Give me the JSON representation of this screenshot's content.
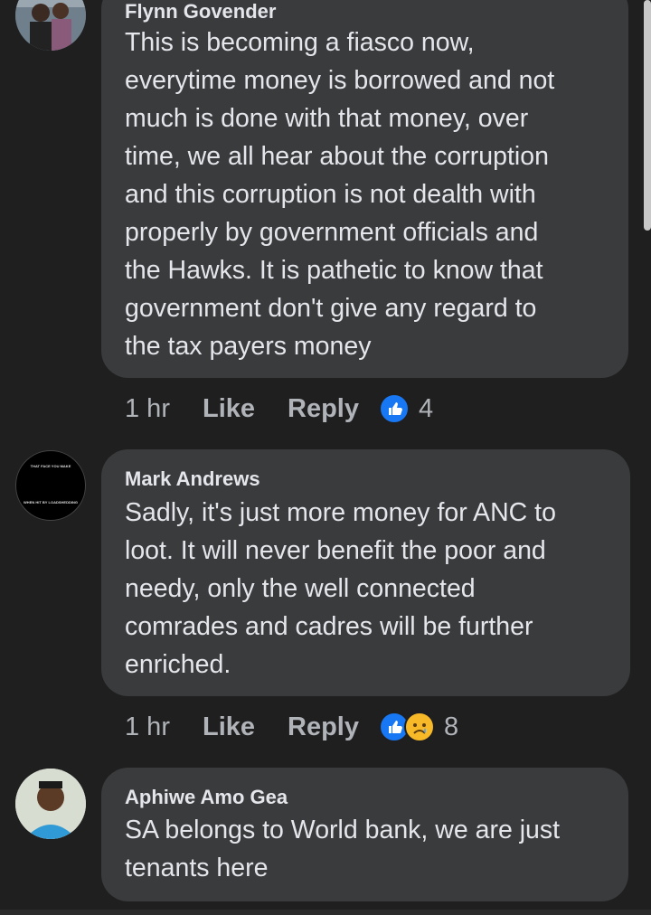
{
  "comments": [
    {
      "author": "Flynn Govender",
      "text": "This is becoming a fiasco now,\neverytime money is borrowed and not\nmuch is done with that money, over\ntime, we all hear about the corruption\nand this corruption is not dealth with\nproperly by government officials and\nthe Hawks. It is pathetic to know that\ngovernment don't give any regard to\nthe tax payers money",
      "time": "1 hr",
      "like_label": "Like",
      "reply_label": "Reply",
      "reaction_count": "4",
      "reactions": [
        "like-icon"
      ]
    },
    {
      "author": "Mark Andrews",
      "avatar_text_top": "THAT FACE YOU MAKE",
      "avatar_text_bottom": "WHEN HIT BY LOADSHEDDING",
      "text": "Sadly, it's just more money for ANC to\nloot. It will never benefit the poor and\nneedy, only the well connected\ncomrades and cadres will be further\nenriched.",
      "time": "1 hr",
      "like_label": "Like",
      "reply_label": "Reply",
      "reaction_count": "8",
      "reactions": [
        "like-icon",
        "sad-icon"
      ]
    },
    {
      "author": "Aphiwe Amo Gea",
      "text": "SA belongs to World bank, we are just\ntenants here"
    }
  ],
  "colors": {
    "background": "#1f1f20",
    "bubble": "#3a3b3c",
    "like_blue": "#1877f2",
    "sad_yellow": "#f7b928"
  }
}
